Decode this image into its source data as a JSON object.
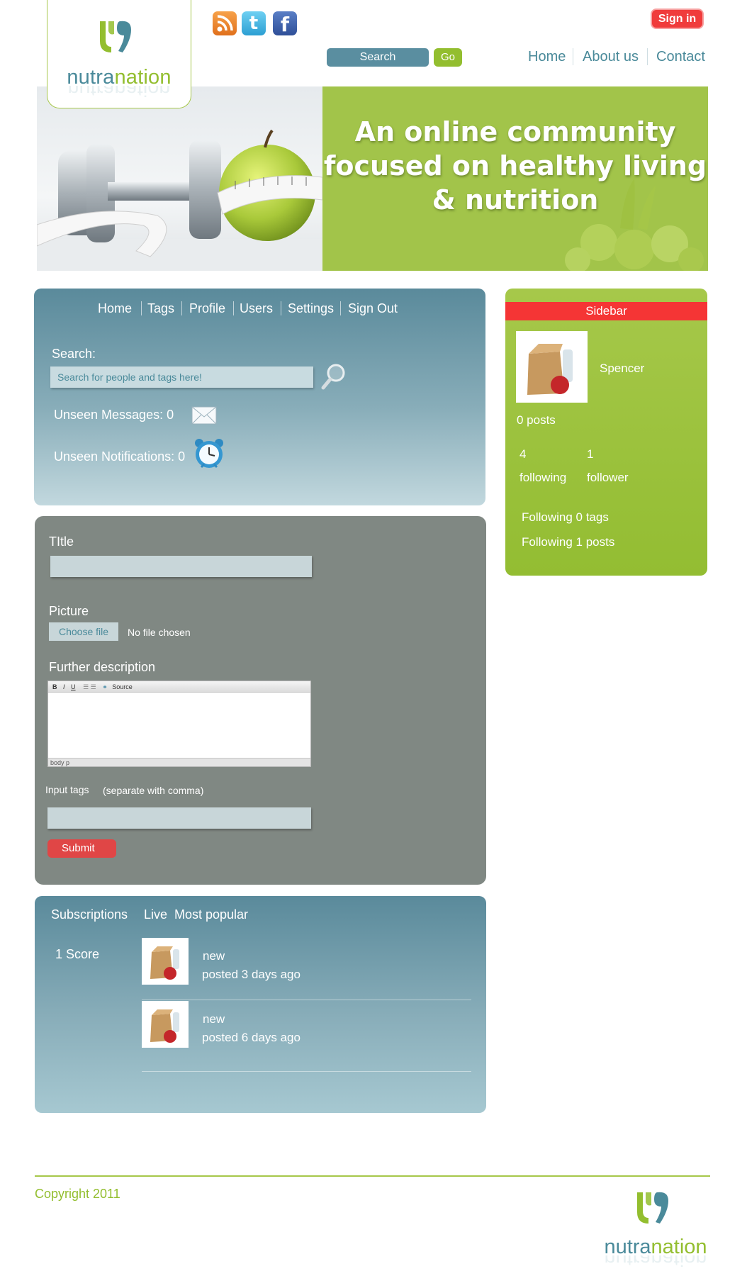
{
  "brand": {
    "name_part1": "nutra",
    "name_part2": "nation"
  },
  "header": {
    "social": [
      {
        "name": "rss-icon"
      },
      {
        "name": "twitter-icon",
        "glyph": "t"
      },
      {
        "name": "facebook-icon",
        "glyph": "f"
      }
    ],
    "signin_label": "Sign in",
    "search_label": "Search",
    "go_label": "Go",
    "nav": [
      "Home",
      "About us",
      "Contact"
    ]
  },
  "banner": {
    "line1": "An online community",
    "line2": "focused on healthy living",
    "line3": "&  nutrition"
  },
  "panel_nav": [
    "Home",
    "Tags",
    "Profile",
    "Users",
    "Settings",
    "Sign Out"
  ],
  "search_panel": {
    "label": "Search:",
    "placeholder": "Search for people and tags here!",
    "unseen_messages": "Unseen Messages: 0",
    "unseen_notifications": "Unseen Notifications: 0"
  },
  "post_form": {
    "title_label": "TItle",
    "picture_label": "Picture",
    "choose_file": "Choose file",
    "no_file": "No file chosen",
    "description_label": "Further description",
    "editor_toolbar": [
      "B",
      "I",
      "U",
      "Source"
    ],
    "editor_status": "body  p",
    "tags_label": "Input tags",
    "tags_hint": "(separate with comma)",
    "submit_label": "Submit"
  },
  "feed": {
    "tabs": [
      "Subscriptions",
      "Live",
      "Most popular"
    ],
    "score": "1 Score",
    "items": [
      {
        "title": "new",
        "meta": "posted 3 days ago"
      },
      {
        "title": "new",
        "meta": "posted 6 days ago"
      }
    ]
  },
  "sidebar": {
    "title": "Sidebar",
    "username": "Spencer",
    "posts": "0 posts",
    "following_count": "4",
    "following_label": "following",
    "follower_count": "1",
    "follower_label": "follower",
    "following_tags": "Following  0 tags",
    "following_posts": "Following  1 posts"
  },
  "footer": {
    "copyright": "Copyright 2011"
  },
  "colors": {
    "brand_green": "#93be2f",
    "brand_teal": "#4a8a9a",
    "alert_red": "#f03b3b",
    "panel_gray": "#808883"
  }
}
